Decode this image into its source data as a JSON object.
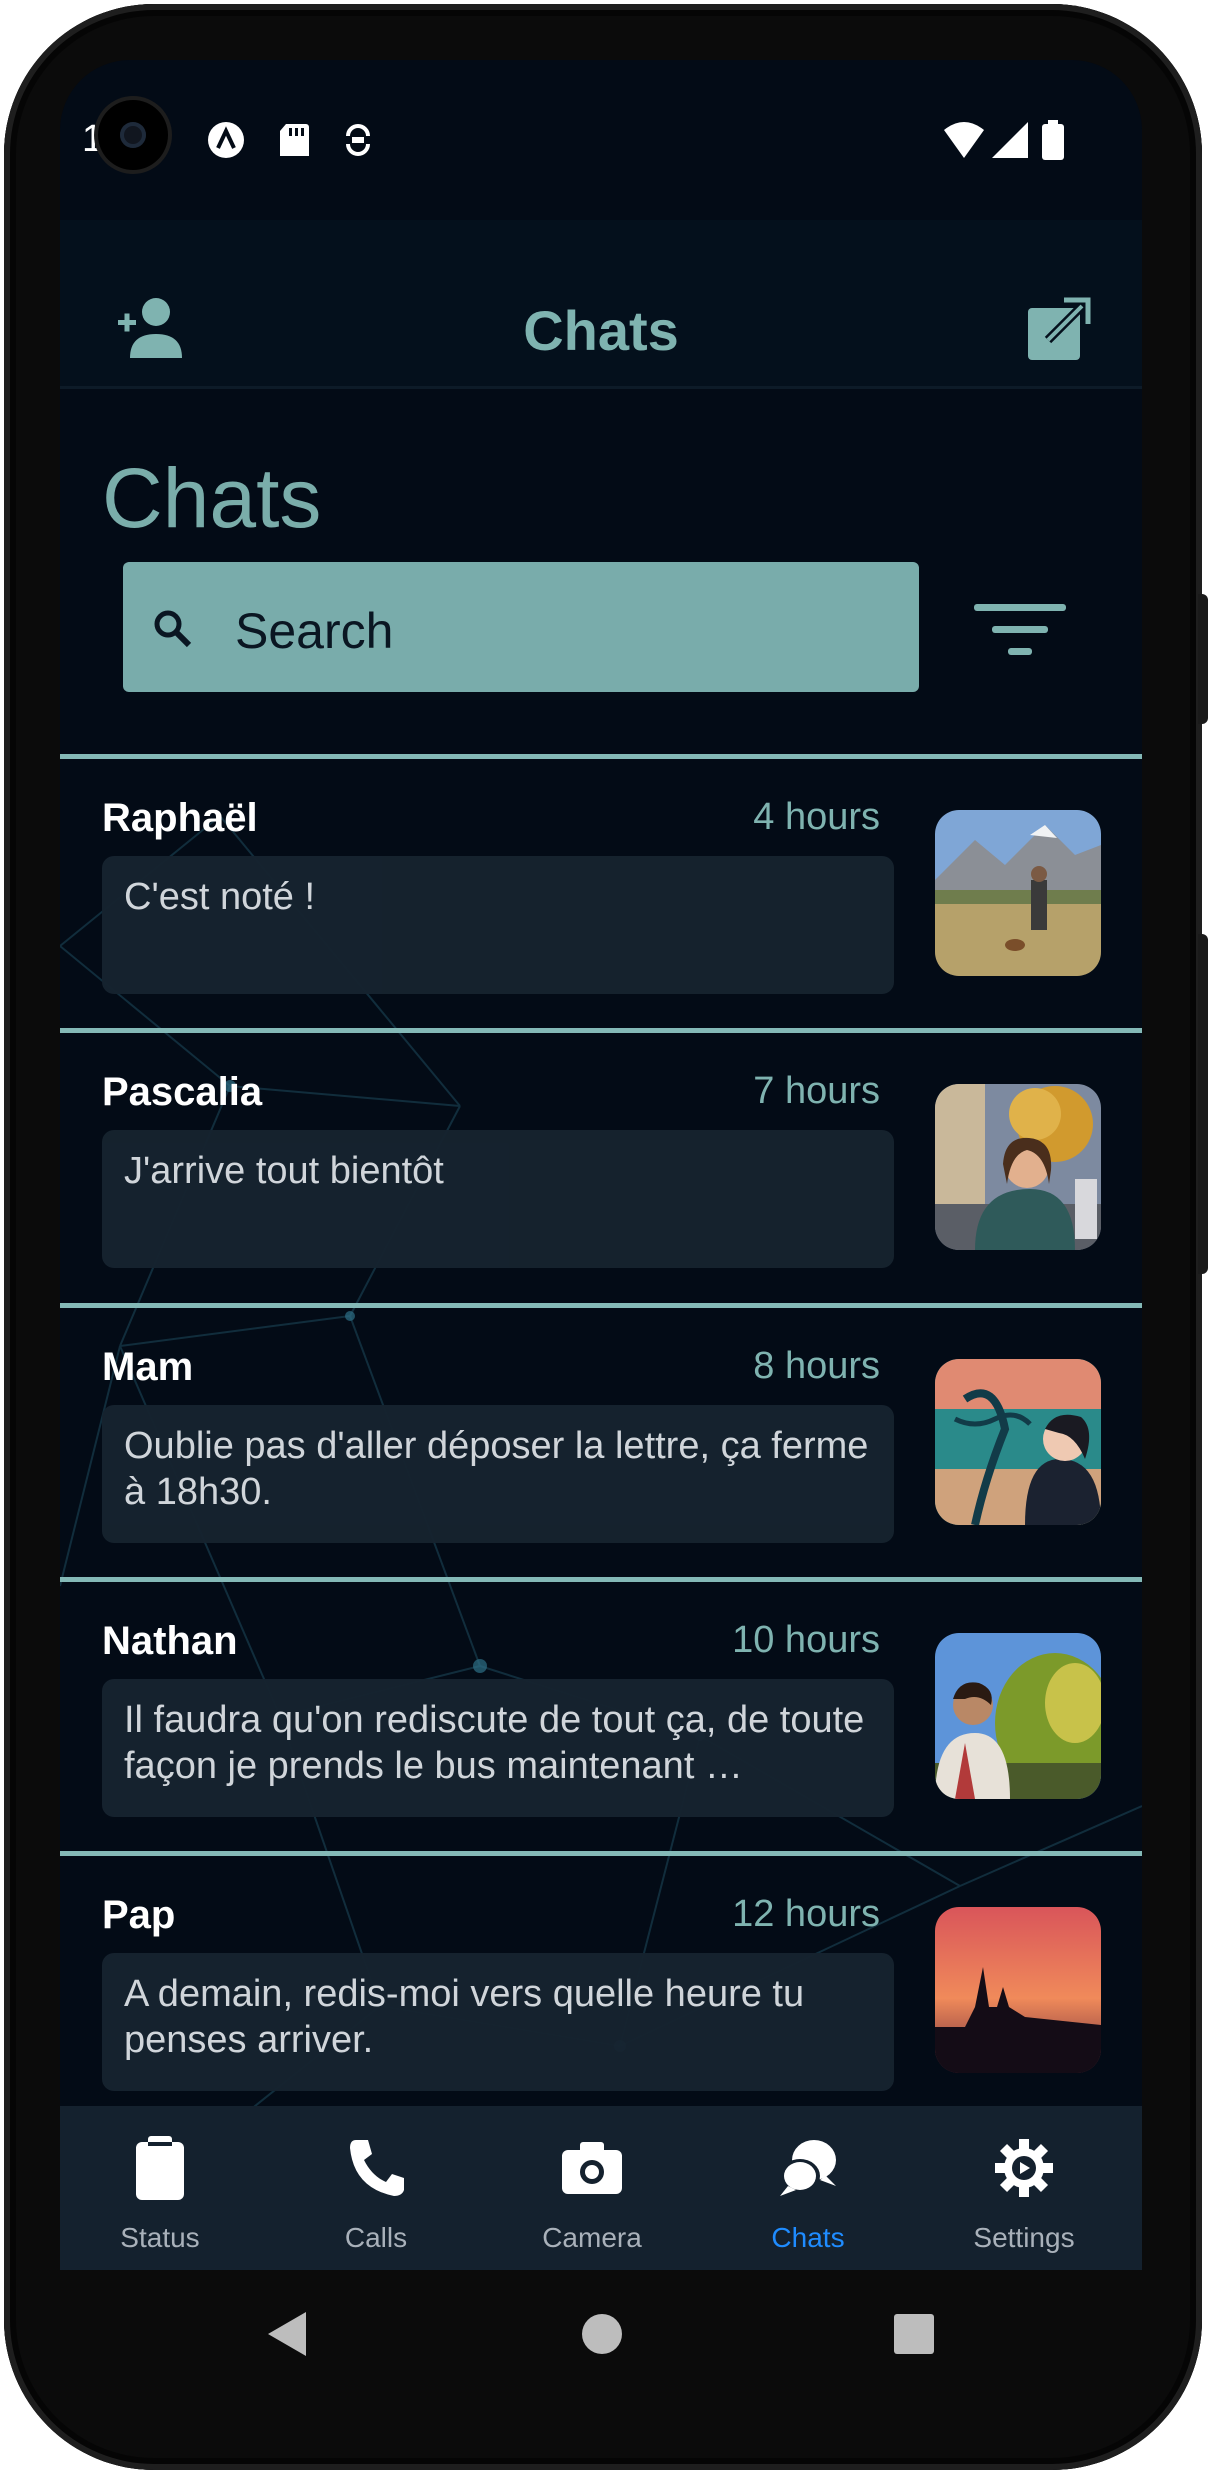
{
  "status_bar": {
    "time": "1   7",
    "icons": [
      "at-sign-icon",
      "sd-card-icon",
      "sync-icon",
      "wifi-icon",
      "signal-icon",
      "battery-icon"
    ]
  },
  "app_bar": {
    "title": "Chats",
    "left_icon": "add-person-icon",
    "right_icon": "compose-icon"
  },
  "page_title": "Chats",
  "search": {
    "placeholder": "Search"
  },
  "chats": [
    {
      "name": "Raphaël",
      "time": "4 hours",
      "message": "C'est noté !"
    },
    {
      "name": "Pascalia",
      "time": "7 hours",
      "message": "J'arrive tout bientôt"
    },
    {
      "name": "Mam",
      "time": "8 hours",
      "message": "Oublie pas d'aller déposer la lettre, ça ferme à 18h30."
    },
    {
      "name": "Nathan",
      "time": "10 hours",
      "message": "Il faudra qu'on rediscute de tout ça, de toute façon je prends le bus maintenant …"
    },
    {
      "name": "Pap",
      "time": "12 hours",
      "message": "A demain, redis-moi vers quelle heure tu penses arriver."
    }
  ],
  "bottom_nav": {
    "items": [
      {
        "label": "Status",
        "icon": "clipboard-icon"
      },
      {
        "label": "Calls",
        "icon": "phone-icon"
      },
      {
        "label": "Camera",
        "icon": "camera-icon"
      },
      {
        "label": "Chats",
        "icon": "chat-bubbles-icon"
      },
      {
        "label": "Settings",
        "icon": "gear-icon"
      }
    ],
    "active": "Chats"
  },
  "colors": {
    "accent": "#79acab",
    "background": "#030b16",
    "active_nav": "#1f8cff"
  }
}
